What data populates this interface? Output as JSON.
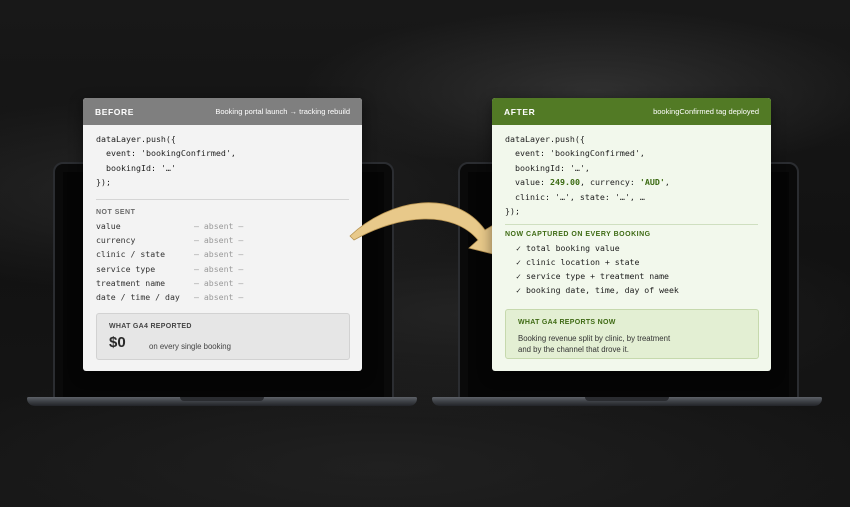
{
  "before": {
    "label": "BEFORE",
    "subtitle": "Booking portal launch → tracking rebuild",
    "code": [
      "dataLayer.push({",
      "  event: 'bookingConfirmed',",
      "  bookingId: '…'",
      "});"
    ],
    "not_sent_title": "NOT SENT",
    "absent_rows": [
      {
        "key": "value",
        "val": "— absent —"
      },
      {
        "key": "currency",
        "val": "— absent —"
      },
      {
        "key": "clinic / state",
        "val": "— absent —"
      },
      {
        "key": "service type",
        "val": "— absent —"
      },
      {
        "key": "treatment name",
        "val": "— absent —"
      },
      {
        "key": "date / time / day",
        "val": "— absent —"
      }
    ],
    "report": {
      "title": "WHAT GA4 REPORTED",
      "amount": "$0",
      "note": "on every single booking"
    }
  },
  "after": {
    "label": "AFTER",
    "subtitle": "bookingConfirmed tag deployed",
    "code": {
      "l1": "dataLayer.push({",
      "l2": "  event: 'bookingConfirmed',",
      "l3": "  bookingId: '…',",
      "l4a": "  value: ",
      "l4b": "249.00",
      "l4c": ", currency: ",
      "l4d": "'AUD'",
      "l4e": ",",
      "l5": "  clinic: '…', state: '…', …",
      "l6": "});"
    },
    "captured_title": "NOW CAPTURED ON EVERY BOOKING",
    "check_mark": "✓",
    "captured_items": [
      "total booking value",
      "clinic location + state",
      "service type + treatment name",
      "booking date, time, day of week"
    ],
    "report": {
      "title": "WHAT GA4 REPORTS NOW",
      "line1": "Booking revenue split by clinic, by treatment",
      "line2": "and by the channel that drove it."
    }
  },
  "colors": {
    "before_header": "#7f7f7f",
    "after_header": "#527a25",
    "arrow": "#e8c98a"
  }
}
